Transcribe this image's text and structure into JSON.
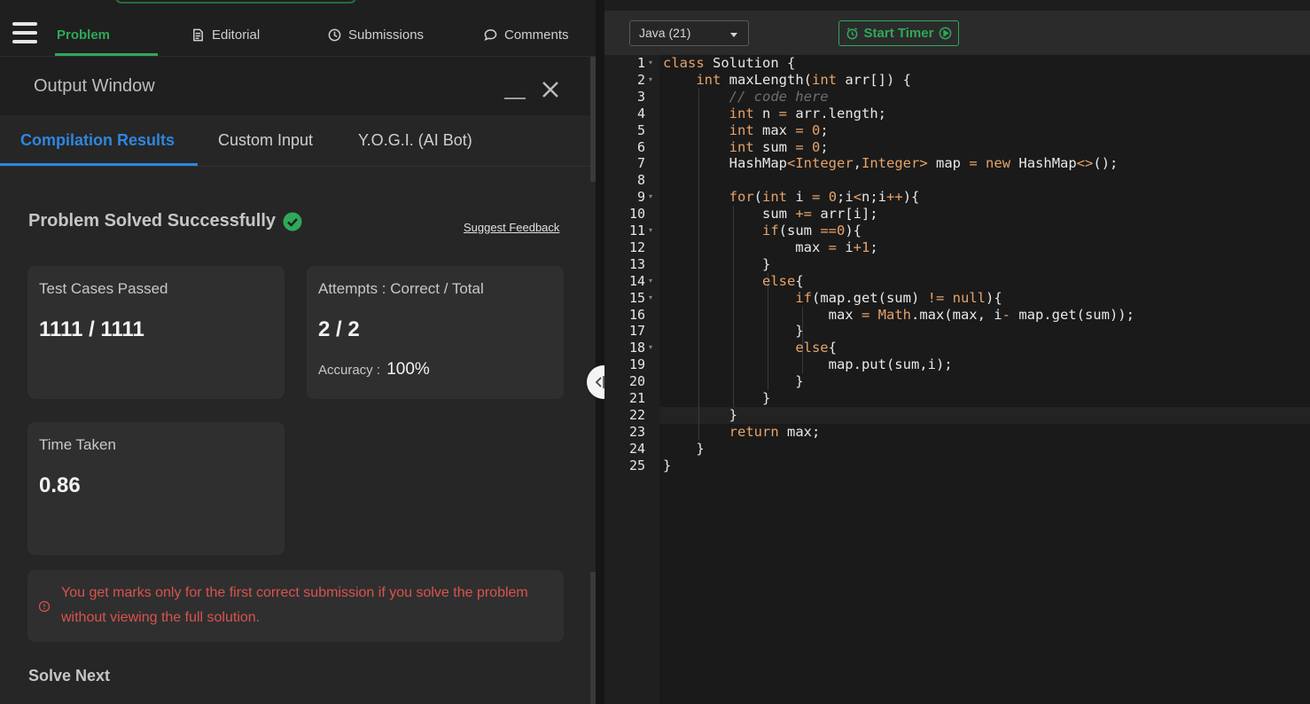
{
  "nav": {
    "tabs": [
      {
        "label": "Problem",
        "icon": "none"
      },
      {
        "label": "Editorial",
        "icon": "document-icon"
      },
      {
        "label": "Submissions",
        "icon": "clock-icon"
      },
      {
        "label": "Comments",
        "icon": "chat-icon"
      }
    ],
    "active_color": "#2fa85a"
  },
  "output_window": {
    "title": "Output Window",
    "tabs": [
      "Compilation Results",
      "Custom Input",
      "Y.O.G.I. (AI Bot)"
    ],
    "active_color": "#2f86e0"
  },
  "result": {
    "status": "Problem Solved Successfully",
    "suggest_feedback": "Suggest Feedback",
    "test_cases_label": "Test Cases Passed",
    "test_cases_value": "1111 / 1111",
    "attempts_label": "Attempts : Correct / Total",
    "attempts_value": "2 / 2",
    "accuracy_label": "Accuracy :",
    "accuracy_value": "100%",
    "time_label": "Time Taken",
    "time_value": "0.86",
    "notice": "You get marks only for the first correct submission if you solve the problem without viewing the full solution.",
    "solve_next": "Solve Next"
  },
  "editor": {
    "language": "Java (21)",
    "timer_button": "Start Timer",
    "line_numbers": [
      "1",
      "2",
      "3",
      "4",
      "5",
      "6",
      "7",
      "8",
      "9",
      "10",
      "11",
      "12",
      "13",
      "14",
      "15",
      "16",
      "17",
      "18",
      "19",
      "20",
      "21",
      "22",
      "23",
      "24",
      "25"
    ],
    "code": [
      "class Solution {",
      "    int maxLength(int arr[]) {",
      "        // code here",
      "        int n = arr.length;",
      "        int max = 0;",
      "        int sum = 0;",
      "        HashMap<Integer,Integer> map = new HashMap<>();",
      "",
      "        for(int i = 0;i<n;i++){",
      "            sum += arr[i];",
      "            if(sum ==0){",
      "                max = i+1;",
      "            }",
      "            else{",
      "                if(map.get(sum) != null){",
      "                    max = Math.max(max, i- map.get(sum));",
      "                }",
      "                else{",
      "                    map.put(sum,i);",
      "                }",
      "            }",
      "        }",
      "        return max;",
      "    }",
      "}"
    ]
  }
}
